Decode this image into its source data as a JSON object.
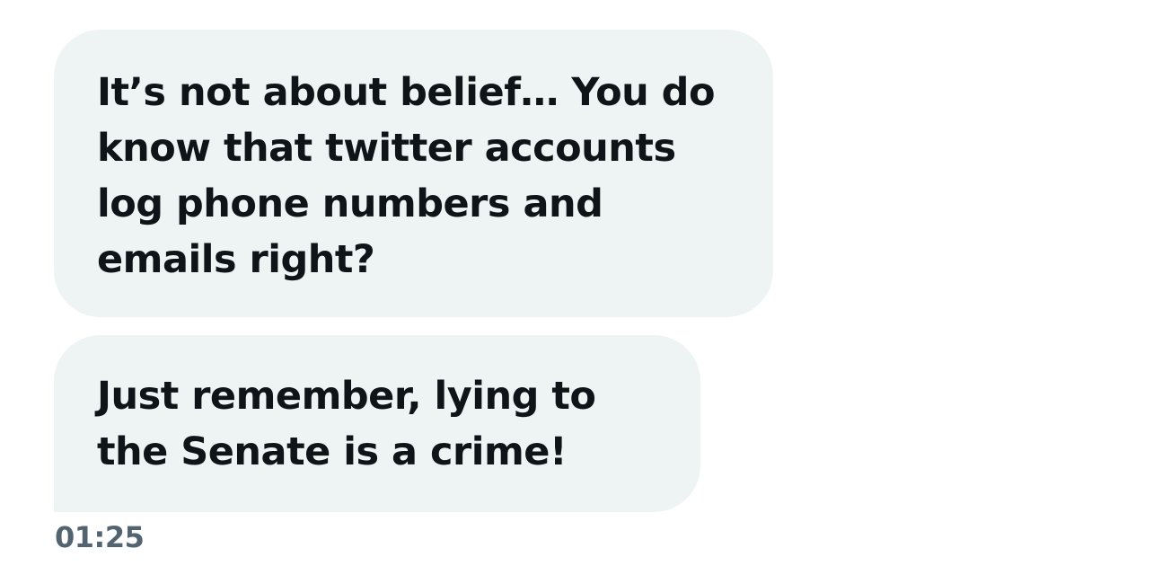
{
  "messages": [
    {
      "text": "It’s not about belief… You do know that twitter accounts log phone numbers and emails right?"
    },
    {
      "text": "Just remember, lying to the Senate is a crime!"
    }
  ],
  "timestamp": "01:25",
  "colors": {
    "bubble_background": "#eef3f4",
    "text": "#0f1419",
    "timestamp": "#536471"
  }
}
